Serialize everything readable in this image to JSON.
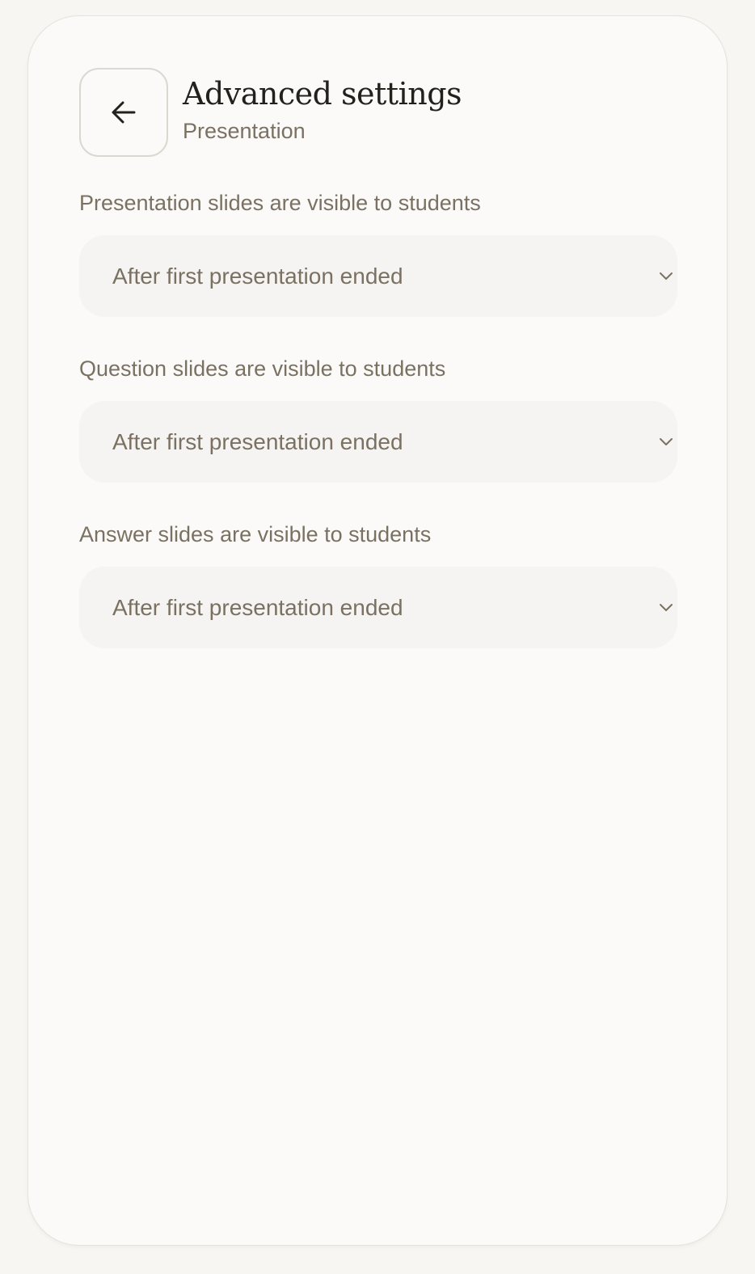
{
  "header": {
    "back_icon": "arrow-left-icon",
    "title": "Advanced settings",
    "subtitle": "Presentation"
  },
  "settings": [
    {
      "label": "Presentation slides are visible to students",
      "value": "After first presentation ended"
    },
    {
      "label": "Question slides are visible to students",
      "value": "After first presentation ended"
    },
    {
      "label": "Answer slides are visible to students",
      "value": "After first presentation ended"
    }
  ],
  "colors": {
    "background": "#f8f6f3",
    "panel": "#fbfaf8",
    "title_text": "#24211d",
    "muted_text": "#7a7162",
    "select_bg": "#f5f4f2"
  }
}
